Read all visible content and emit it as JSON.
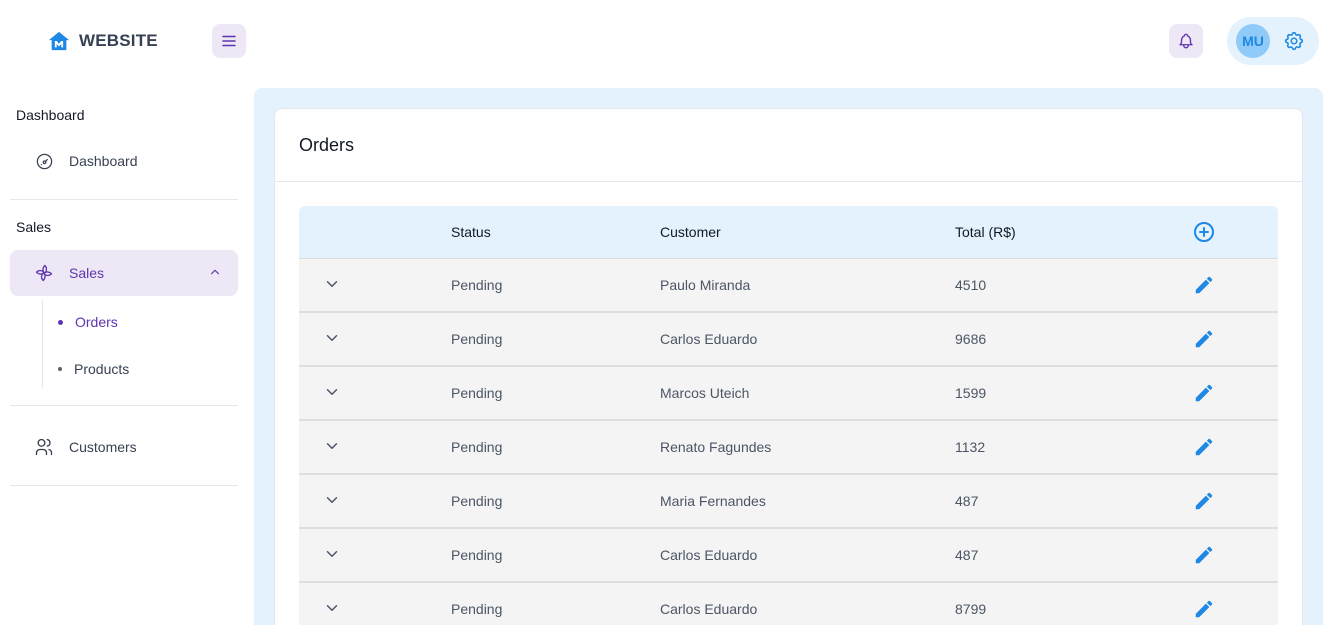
{
  "app": {
    "brand": "WEBSITE"
  },
  "header": {
    "avatar_initials": "MU"
  },
  "sidebar": {
    "sections": [
      {
        "title": "Dashboard"
      },
      {
        "title": "Sales"
      }
    ],
    "items": {
      "dashboard": "Dashboard",
      "sales": "Sales",
      "orders": "Orders",
      "products": "Products",
      "customers": "Customers"
    }
  },
  "main": {
    "title": "Orders",
    "columns": [
      "Status",
      "Customer",
      "Total (R$)"
    ],
    "rows": [
      {
        "status": "Pending",
        "customer": "Paulo Miranda",
        "total": "4510"
      },
      {
        "status": "Pending",
        "customer": "Carlos Eduardo",
        "total": "9686"
      },
      {
        "status": "Pending",
        "customer": "Marcos Uteich",
        "total": "1599"
      },
      {
        "status": "Pending",
        "customer": "Renato Fagundes",
        "total": "1132"
      },
      {
        "status": "Pending",
        "customer": "Maria Fernandes",
        "total": "487"
      },
      {
        "status": "Pending",
        "customer": "Carlos Eduardo",
        "total": "487"
      },
      {
        "status": "Pending",
        "customer": "Carlos Eduardo",
        "total": "8799"
      }
    ]
  },
  "colors": {
    "accent_purple": "#5e35b1",
    "accent_blue": "#1e88e5",
    "light_blue": "#e3f2fd",
    "light_purple": "#ede7f6"
  },
  "icons": [
    "logo-icon",
    "menu-icon",
    "bell-icon",
    "settings-icon",
    "dashboard-icon",
    "sales-icon",
    "chevron-up-icon",
    "customers-icon",
    "add-circle-icon",
    "chevron-down-icon",
    "edit-icon"
  ]
}
